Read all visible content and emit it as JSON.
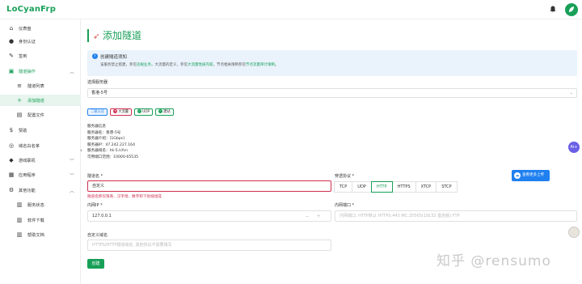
{
  "app": {
    "logo": "LoCyanFrp",
    "avatar_letter": ""
  },
  "sidebar": {
    "items": [
      {
        "label": "仪表盘",
        "icon": "home-icon"
      },
      {
        "label": "身份认证",
        "icon": "user-icon"
      },
      {
        "label": "签到",
        "icon": "pen-icon"
      },
      {
        "label": "隧道操作",
        "icon": "tunnel-icon"
      },
      {
        "label": "隧道列表",
        "icon": "list-icon"
      },
      {
        "label": "添加隧道",
        "icon": "plus-icon"
      },
      {
        "label": "配置文件",
        "icon": "file-icon"
      },
      {
        "label": "赞助",
        "icon": "dollar-icon"
      },
      {
        "label": "域名白名单",
        "icon": "globe-icon"
      },
      {
        "label": "游戏联机",
        "icon": "gamepad-icon"
      },
      {
        "label": "应用程序",
        "icon": "apps-icon"
      },
      {
        "label": "其他功能",
        "icon": "gear-icon"
      },
      {
        "label": "服务状态",
        "icon": "status-icon"
      },
      {
        "label": "软件下载",
        "icon": "download-icon"
      },
      {
        "label": "帮助文档",
        "icon": "book-icon"
      }
    ]
  },
  "page": {
    "title": "添加隧道"
  },
  "notice": {
    "title": "创建隧道须知",
    "text_1": "该服务禁止搭建，参见",
    "link_1": "违规业务",
    "text_2": "，大流量的定义，参见",
    "link_2": "大流量性质内容",
    "text_3": "，节点相关限制参见",
    "link_3": "节点流量审计限制",
    "text_4": "。"
  },
  "server": {
    "label": "选择服务器",
    "value": "香港-5号"
  },
  "tags": {
    "t1": "二级认证",
    "t2": "大流量",
    "t3": "UDP",
    "t4": "建站"
  },
  "server_info": {
    "heading": "服务器信息",
    "name": "服务器名：香港-5号",
    "desc": "服务器介绍：[1Gbps]",
    "ip": "服务器IP：47.242.227.164",
    "domain": "服务器域名：hk-5.lcfcn",
    "ports": "可用端口范围：10000-65535"
  },
  "form": {
    "tunnel_name_label": "隧道名 *",
    "tunnel_name_value": "自定义",
    "tunnel_name_error": "隧道名称仅限英、汉字母、数字和下划线组成",
    "local_ip_label": "内网IP *",
    "local_ip_value": "127.0.0.1",
    "protocol_label": "穿透协议 *",
    "protocols": [
      "TCP",
      "UDP",
      "HTTP",
      "HTTPS",
      "XTCP",
      "STCP"
    ],
    "protocol_selected": "HTTP",
    "local_port_label": "内网端口 *",
    "local_port_placeholder": "内网端口, HTTP默认 HTTPS:443 MC:25565(19132 基岩版) FTP",
    "domain_label": "自定义域名",
    "domain_placeholder": "HTTPS/HTTP隧道域名, 其他协议不需要填写",
    "create_button": "创建",
    "upload_button": "查看更多上传"
  },
  "watermark": "知乎 @rensumo",
  "fab": {
    "label": "Ai+"
  },
  "colors": {
    "accent": "#18a058",
    "info": "#2080f0",
    "error": "#d03050"
  }
}
